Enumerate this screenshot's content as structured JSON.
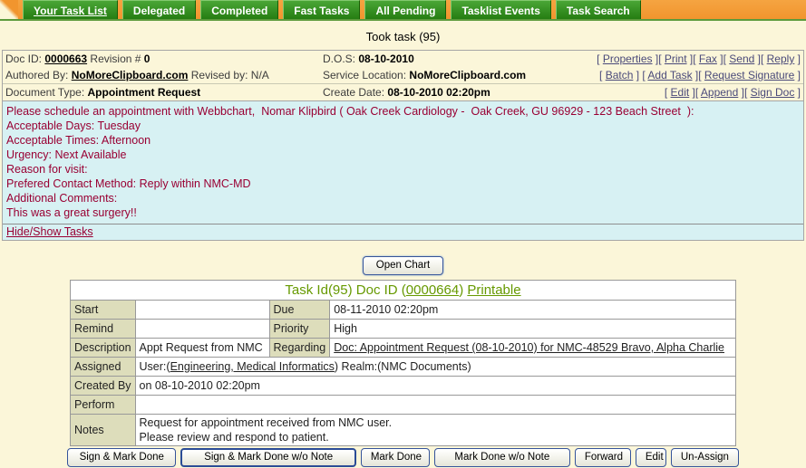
{
  "colors": {
    "tab_green": "#2E8B1E",
    "bar_orange": "#F1952E",
    "page_bg": "#FBF6D9",
    "message_bg": "#D7F1F3",
    "message_text": "#990033",
    "label_cell_bg": "#DDDDBB",
    "priority_high": "#E80000",
    "table_title_green": "#669900",
    "header_link": "#4A4A7A"
  },
  "tabs": [
    {
      "label": "Your Task List",
      "active": true
    },
    {
      "label": "Delegated",
      "active": false
    },
    {
      "label": "Completed",
      "active": false
    },
    {
      "label": "Fast Tasks",
      "active": false
    },
    {
      "label": "All Pending",
      "active": false
    },
    {
      "label": "Tasklist Events",
      "active": false
    },
    {
      "label": "Task Search",
      "active": false
    }
  ],
  "status_message": "Took task (95)",
  "doc_header": {
    "row1": {
      "doc_id_label": "Doc ID:",
      "doc_id_link": "0000663",
      "revision_label": "Revision #",
      "revision_value": "0",
      "dos_label": "D.O.S:",
      "dos_value": "08-10-2010",
      "links": [
        "Properties",
        "Print",
        "Fax",
        "Send",
        "Reply"
      ]
    },
    "row2": {
      "authored_label": "Authored By:",
      "authored_link": "NoMoreClipboard.com",
      "revised_label": "Revised by:",
      "revised_value": "N/A",
      "service_label": "Service Location:",
      "service_value": "NoMoreClipboard.com",
      "links": [
        "Batch",
        "Add Task",
        "Request Signature"
      ]
    },
    "row3": {
      "doctype_label": "Document Type:",
      "doctype_value": "Appointment Request",
      "create_label": "Create Date:",
      "create_value": "08-10-2010 02:20pm",
      "links": [
        "Edit",
        "Append",
        "Sign Doc"
      ]
    }
  },
  "request_message": {
    "lines": [
      "Please schedule an appointment with Webbchart,  Nomar Klipbird ( Oak Creek Cardiology -  Oak Creek, GU 96929 - 123 Beach Street  ):",
      "Acceptable Days: Tuesday",
      "Acceptable Times: Afternoon",
      "Urgency: Next Available",
      "Reason for visit:",
      "Prefered Contact Method: Reply within NMC-MD",
      "Additional Comments:",
      "This was a great surgery!!"
    ],
    "toggle_link": "Hide/Show Tasks"
  },
  "open_chart_button": "Open Chart",
  "task_table": {
    "title_prefix": "Task Id(95) Doc ID (",
    "title_doc_link": "0000664",
    "title_close": ") ",
    "printable_link": "Printable",
    "rows": {
      "start_label": "Start",
      "start_value": "",
      "due_label": "Due",
      "due_value": "08-11-2010 02:20pm",
      "remind_label": "Remind",
      "remind_value": "",
      "priority_label": "Priority",
      "priority_value": "High",
      "description_label": "Description",
      "description_value": "Appt Request from NMC",
      "regarding_label": "Regarding",
      "regarding_link": "Doc: Appointment Request (08-10-2010) for NMC-48529 Bravo, Alpha Charlie",
      "assigned_label": "Assigned",
      "assigned_prefix": "User:(",
      "assigned_user_link": "Engineering, Medical Informatics",
      "assigned_suffix": ") Realm:(NMC Documents)",
      "created_by_label": "Created By",
      "created_by_value": " on 08-10-2010 02:20pm",
      "perform_label": "Perform",
      "perform_value": "",
      "notes_label": "Notes",
      "notes_line1": "Request for appointment received from NMC user.",
      "notes_line2": "Please review and respond to patient."
    }
  },
  "action_buttons": [
    "Sign & Mark Done",
    "Sign & Mark Done w/o Note",
    "Mark Done",
    "Mark Done w/o Note",
    "Forward",
    "Edit",
    "Un-Assign"
  ]
}
